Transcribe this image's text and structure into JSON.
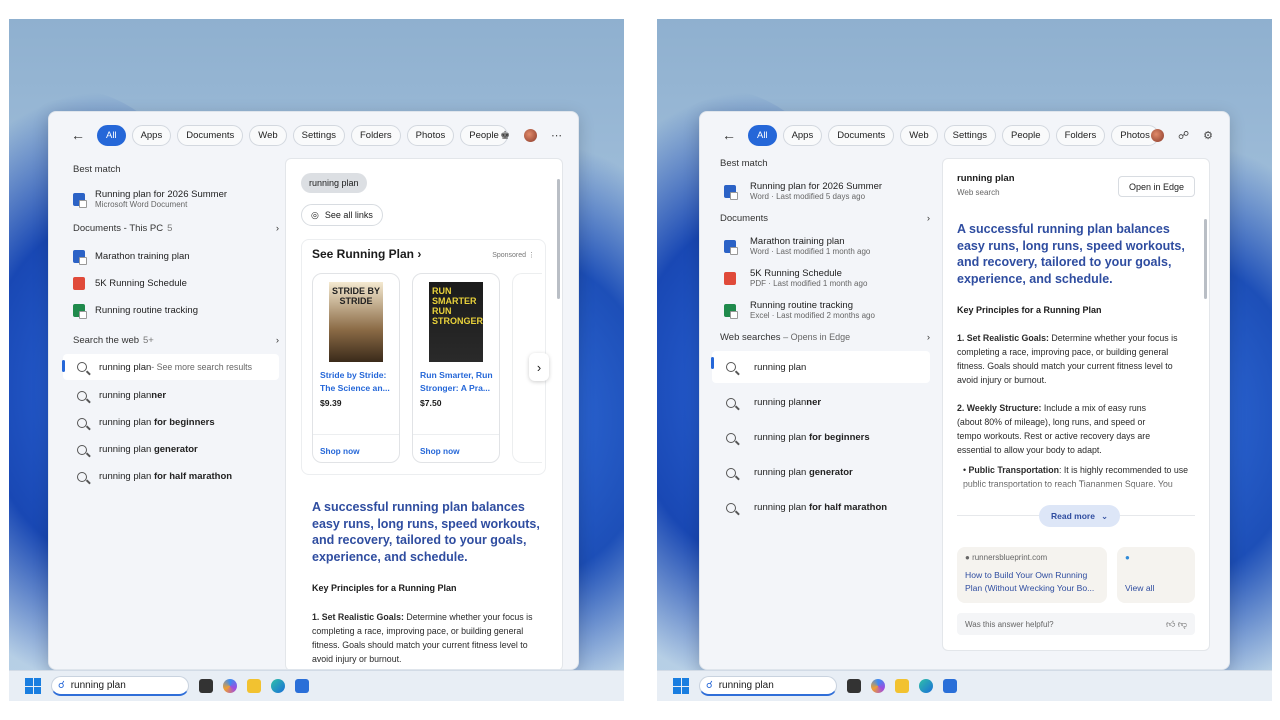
{
  "taskbar": {
    "search_value": "running plan"
  },
  "left": {
    "filters": [
      "All",
      "Apps",
      "Documents",
      "Web",
      "Settings",
      "Folders",
      "Photos",
      "People"
    ],
    "best_match_heading": "Best match",
    "best_match": {
      "title": "Running plan for 2026 Summer",
      "subtitle": "Microsoft Word Document"
    },
    "documents_heading": "Documents - This PC",
    "documents_count": "5",
    "documents": [
      {
        "name": "Marathon training plan",
        "type": "word"
      },
      {
        "name": "5K Running Schedule",
        "type": "pdf"
      },
      {
        "name": "Running routine tracking",
        "type": "excel"
      }
    ],
    "web_heading": "Search the web",
    "web_count": "5+",
    "web_searches": [
      {
        "query": "running plan",
        "suffix": " - See more search results"
      },
      {
        "query": "running plan",
        "bold": "ner"
      },
      {
        "query": "running plan ",
        "bold": "for beginners"
      },
      {
        "query": "running plan ",
        "bold": "generator"
      },
      {
        "query": "running plan ",
        "bold": "for half marathon"
      }
    ],
    "preview": {
      "query_chip": "running plan",
      "see_all_links": "See all links",
      "shopping_title": "See Running Plan",
      "sponsored": "Sponsored",
      "books": [
        {
          "title": "Stride by Stride: The Science an...",
          "price": "$9.39",
          "shop": "Shop now",
          "cover_text": "STRIDE BY STRIDE"
        },
        {
          "title": "Run Smarter, Run Stronger: A Pra...",
          "price": "$7.50",
          "shop": "Shop now",
          "cover_text": "RUN SMARTER RUN STRONGER"
        }
      ],
      "answer": "A successful running plan balances easy runs, long runs, speed workouts, and recovery, tailored to your goals, experience, and schedule.",
      "principles_heading": "Key Principles for a Running Plan",
      "point1_label": "1. Set Realistic Goals:",
      "point1_text": " Determine whether your focus is completing a race, improving pace, or building general fitness. Goals should match your current fitness level to avoid injury or burnout."
    }
  },
  "right": {
    "filters": [
      "All",
      "Apps",
      "Documents",
      "Web",
      "Settings",
      "People",
      "Folders",
      "Photos"
    ],
    "best_match_heading": "Best match",
    "best_match": {
      "title": "Running plan for 2026 Summer",
      "subtitle": "Word · Last modified 5 days ago"
    },
    "documents_heading": "Documents",
    "documents": [
      {
        "name": "Marathon training plan",
        "meta": "Word · Last modified 1 month ago",
        "type": "word"
      },
      {
        "name": "5K Running Schedule",
        "meta": "PDF · Last modified 1 month ago",
        "type": "pdf"
      },
      {
        "name": "Running routine tracking",
        "meta": "Excel · Last modified 2 months ago",
        "type": "excel"
      }
    ],
    "web_heading": "Web searches",
    "web_heading_suffix": " – Opens in Edge",
    "web_searches": [
      {
        "query": "running plan",
        "bold": ""
      },
      {
        "query": "running plan",
        "bold": "ner"
      },
      {
        "query": "running plan ",
        "bold": "for beginners"
      },
      {
        "query": "running plan ",
        "bold": "generator"
      },
      {
        "query": "running plan ",
        "bold": "for half marathon"
      }
    ],
    "preview": {
      "title": "running plan",
      "subtitle": "Web search",
      "open_button": "Open in Edge",
      "answer": "A successful running plan balances easy runs, long runs, speed workouts, and recovery, tailored to your goals, experience, and schedule.",
      "principles_heading": "Key Principles for a Running Plan",
      "point1_label": "1. Set Realistic Goals:",
      "point1_text": " Determine whether your focus is completing a race, improving pace, or building general fitness. Goals should match your current fitness level to avoid injury or burnout.",
      "point2_label": "2. Weekly Structure:",
      "point2_text": " Include a mix of easy runs (about 80% of mileage), long runs, and speed or tempo workouts. Rest or active recovery days are essential to allow your body to adapt.",
      "bullet_label": "Public Transportation",
      "bullet_text": ": It is highly recommended to use public transportation to reach Tiananmen Square. You",
      "read_more": "Read more",
      "source_domain": "runnersblueprint.com",
      "source_title": "How to Build Your Own Running Plan (Without Wrecking Your Bo...",
      "view_all": "View all",
      "feedback": "Was this answer helpful?"
    }
  },
  "colors": {
    "accent": "#2567d8",
    "answer_blue": "#2f4da0"
  }
}
